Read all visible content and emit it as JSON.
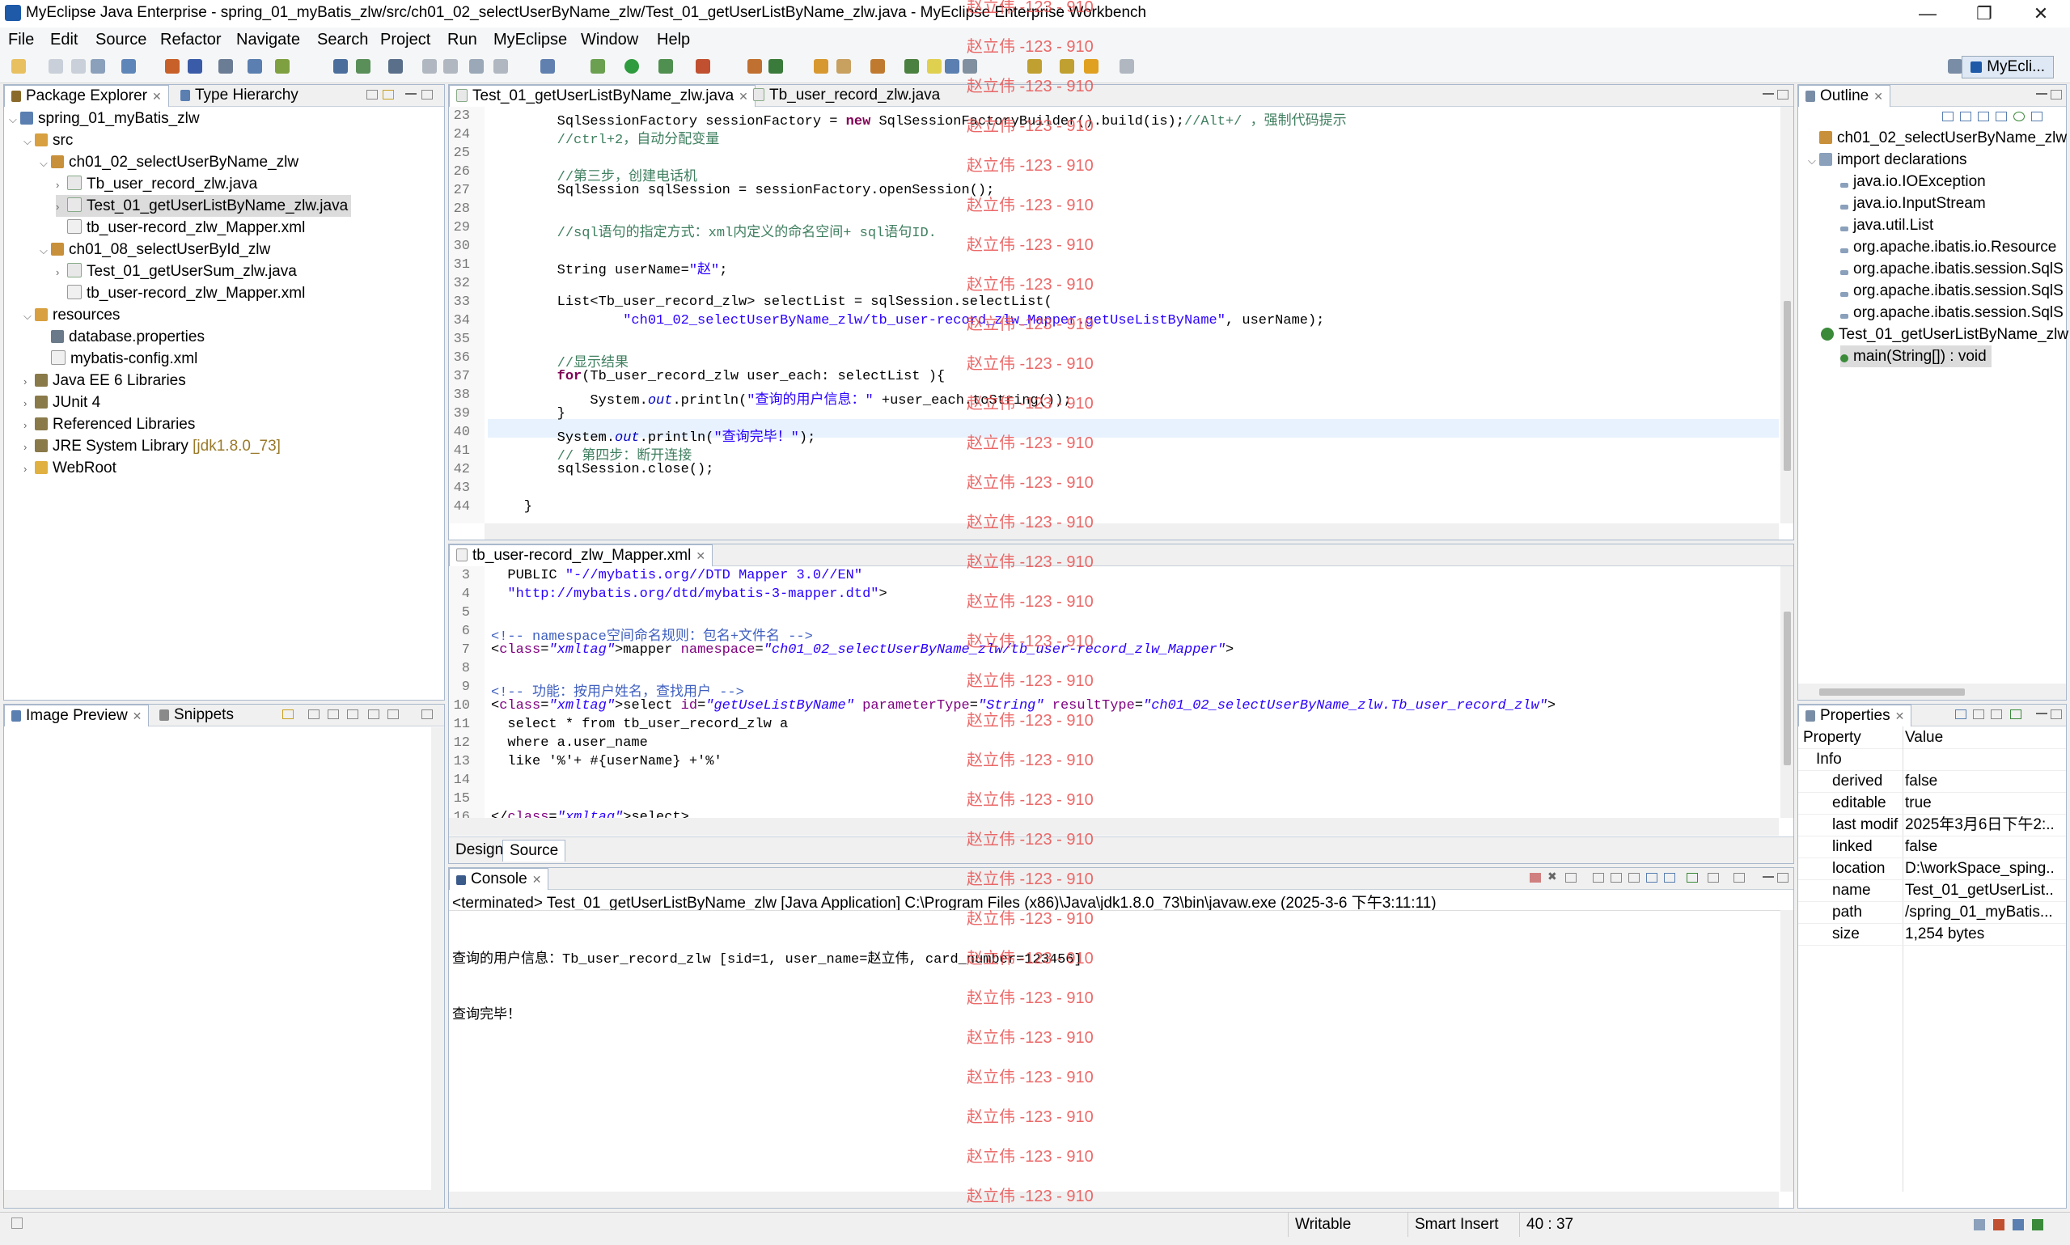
{
  "window": {
    "title": "MyEclipse Java Enterprise - spring_01_myBatis_zlw/src/ch01_02_selectUserByName_zlw/Test_01_getUserListByName_zlw.java - MyEclipse Enterprise Workbench",
    "minimize": "—",
    "maximize": "❐",
    "close": "✕"
  },
  "menu": [
    "File",
    "Edit",
    "Source",
    "Refactor",
    "Navigate",
    "Search",
    "Project",
    "Run",
    "MyEclipse",
    "Window",
    "Help"
  ],
  "perspective": "MyEcli...",
  "package_explorer": {
    "tabs": [
      "Package Explorer",
      "Type Hierarchy"
    ],
    "items": [
      "spring_01_myBatis_zlw",
      "src",
      "ch01_02_selectUserByName_zlw",
      "Tb_user_record_zlw.java",
      "Test_01_getUserListByName_zlw.java",
      "tb_user-record_zlw_Mapper.xml",
      "ch01_08_selectUserById_zlw",
      "Test_01_getUserSum_zlw.java",
      "tb_user-record_zlw_Mapper.xml",
      "resources",
      "database.properties",
      "mybatis-config.xml",
      "Java EE 6 Libraries",
      "JUnit 4",
      "Referenced Libraries",
      "JRE System Library",
      "WebRoot"
    ],
    "jre_suffix": "[jdk1.8.0_73]"
  },
  "image_preview": {
    "tabs": [
      "Image Preview",
      "Snippets"
    ]
  },
  "editor": {
    "tabs": [
      "Test_01_getUserListByName_zlw.java",
      "Tb_user_record_zlw.java"
    ],
    "line_numbers": [
      "23",
      "24",
      "25",
      "26",
      "27",
      "28",
      "29",
      "30",
      "31",
      "32",
      "33",
      "34",
      "35",
      "36",
      "37",
      "38",
      "39",
      "40",
      "41",
      "42",
      "43",
      "44"
    ],
    "lines": [
      "        SqlSessionFactory sessionFactory = new SqlSessionFactoryBuilder().build(is);//Alt+/ ，强制代码提示",
      "        //ctrl+2，自动分配变量",
      "",
      "        //第三步，创建电话机",
      "        SqlSession sqlSession = sessionFactory.openSession();",
      "",
      "        //sql语句的指定方式：xml内定义的命名空间+ sql语句ID.",
      "",
      "        String userName=\"赵\";",
      "",
      "        List<Tb_user_record_zlw> selectList = sqlSession.selectList(",
      "                \"ch01_02_selectUserByName_zlw/tb_user-record_zlw_Mapper.getUseListByName\", userName);",
      "",
      "        //显示结果",
      "        for(Tb_user_record_zlw user_each: selectList ){",
      "            System.out.println(\"查询的用户信息：\" +user_each.toString());",
      "        }",
      "        System.out.println(\"查询完毕！\");",
      "        // 第四步：断开连接",
      "        sqlSession.close();",
      "",
      "    }"
    ]
  },
  "xml_editor": {
    "tab": "tb_user-record_zlw_Mapper.xml",
    "line_numbers": [
      "3",
      "4",
      "5",
      "6",
      "7",
      "8",
      "9",
      "10",
      "11",
      "12",
      "13",
      "14",
      "15",
      "16"
    ],
    "lines": [
      "  PUBLIC \"-//mybatis.org//DTD Mapper 3.0//EN\"",
      "  \"http://mybatis.org/dtd/mybatis-3-mapper.dtd\">",
      "",
      "<!-- namespace空间命名规则：包名+文件名 -->",
      "<mapper namespace=\"ch01_02_selectUserByName_zlw/tb_user-record_zlw_Mapper\">",
      "",
      "<!-- 功能：按用户姓名，查找用户 -->",
      "<select id=\"getUseListByName\" parameterType=\"String\" resultType=\"ch01_02_selectUserByName_zlw.Tb_user_record_zlw\">",
      "  select * from tb_user_record_zlw a",
      "  where a.user_name",
      "  like '%'+ #{userName} +'%'",
      "",
      "",
      "</select>"
    ],
    "bottom_tabs": [
      "Design",
      "Source"
    ]
  },
  "console": {
    "tab": "Console",
    "header": "<terminated> Test_01_getUserListByName_zlw [Java Application] C:\\Program Files (x86)\\Java\\jdk1.8.0_73\\bin\\javaw.exe (2025-3-6 下午3:11:11)",
    "output": [
      "查询的用户信息：Tb_user_record_zlw [sid=1, user_name=赵立伟, card_number=123456]",
      "查询完毕！"
    ]
  },
  "outline": {
    "tab": "Outline",
    "items": [
      "ch01_02_selectUserByName_zlw",
      "import declarations",
      "java.io.IOException",
      "java.io.InputStream",
      "java.util.List",
      "org.apache.ibatis.io.Resource",
      "org.apache.ibatis.session.SqlS",
      "org.apache.ibatis.session.SqlS",
      "org.apache.ibatis.session.SqlS",
      "Test_01_getUserListByName_zlw",
      "main(String[]) : void"
    ]
  },
  "properties": {
    "tab": "Properties",
    "col_property": "Property",
    "col_value": "Value",
    "group": "Info",
    "rows": [
      {
        "k": "derived",
        "v": "false"
      },
      {
        "k": "editable",
        "v": "true"
      },
      {
        "k": "last modif",
        "v": "2025年3月6日下午2:..."
      },
      {
        "k": "linked",
        "v": "false"
      },
      {
        "k": "location",
        "v": "D:\\workSpace_sping..."
      },
      {
        "k": "name",
        "v": "Test_01_getUserList..."
      },
      {
        "k": "path",
        "v": "/spring_01_myBatis..."
      },
      {
        "k": "size",
        "v": "1,254  bytes"
      }
    ]
  },
  "status": {
    "writable": "Writable",
    "insert_mode": "Smart Insert",
    "position": "40 : 37"
  },
  "watermark": "赵立伟 -123 - 910",
  "colors": {
    "keyword": "#7f0055",
    "comment": "#3f7f5f",
    "string": "#2a00ff",
    "watermark": "#e85050"
  }
}
